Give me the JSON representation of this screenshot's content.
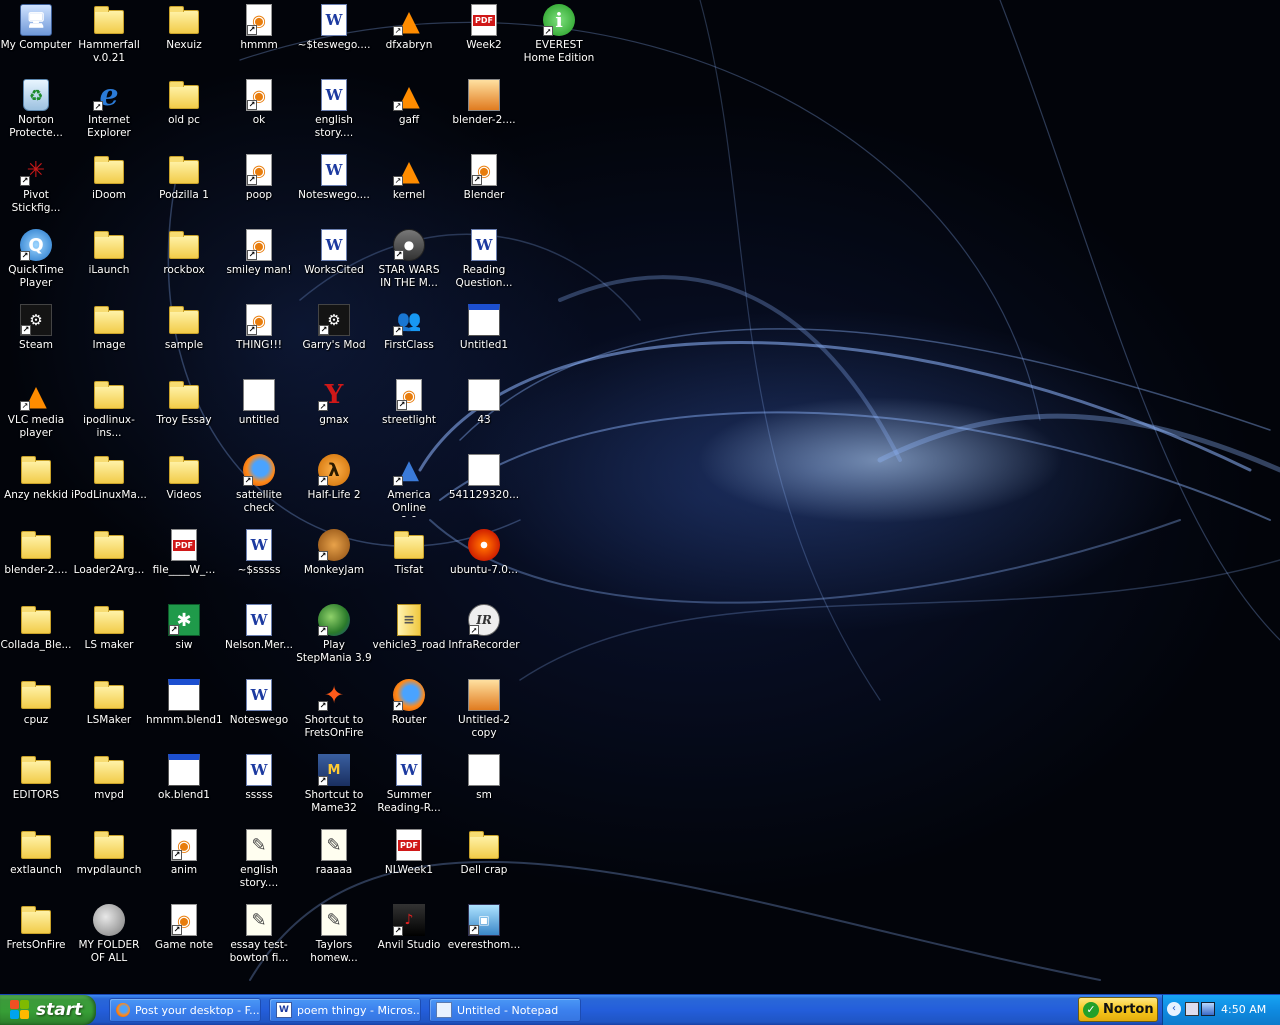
{
  "desktop": {
    "icons": [
      {
        "id": "my-computer",
        "label": "My Computer",
        "glyph": "computer"
      },
      {
        "id": "hammerfall",
        "label": "Hammerfall\nv.0.21",
        "glyph": "folder"
      },
      {
        "id": "nexuiz",
        "label": "Nexuiz",
        "glyph": "folder"
      },
      {
        "id": "hmmm",
        "label": "hmmm",
        "glyph": "blender"
      },
      {
        "id": "teswego",
        "label": "~$teswego....",
        "glyph": "word"
      },
      {
        "id": "dfxabryn",
        "label": "dfxabryn",
        "glyph": "vlc"
      },
      {
        "id": "week2",
        "label": "Week2",
        "glyph": "pdf"
      },
      {
        "id": "everest",
        "label": "EVEREST\nHome Edition",
        "glyph": "info"
      },
      {
        "id": "norton-protected",
        "label": "Norton\nProtecte...",
        "glyph": "recycle"
      },
      {
        "id": "internet-explorer",
        "label": "Internet\nExplorer",
        "glyph": "ie"
      },
      {
        "id": "old-pc",
        "label": "old pc",
        "glyph": "folder"
      },
      {
        "id": "ok",
        "label": "ok",
        "glyph": "blender"
      },
      {
        "id": "english-story-1",
        "label": "english\nstory....",
        "glyph": "word"
      },
      {
        "id": "gaff",
        "label": "gaff",
        "glyph": "vlc"
      },
      {
        "id": "blender-2-a",
        "label": "blender-2....",
        "glyph": "psd"
      },
      {
        "id": "pivot",
        "label": "Pivot\nStickfig...",
        "glyph": "pivot"
      },
      {
        "id": "idoom",
        "label": "iDoom",
        "glyph": "folder"
      },
      {
        "id": "podzilla",
        "label": "Podzilla 1",
        "glyph": "folder"
      },
      {
        "id": "poop",
        "label": "poop",
        "glyph": "blender"
      },
      {
        "id": "noteswego-1",
        "label": "Noteswego....",
        "glyph": "word"
      },
      {
        "id": "kernel",
        "label": "kernel",
        "glyph": "vlc"
      },
      {
        "id": "blender",
        "label": "Blender",
        "glyph": "blender"
      },
      {
        "id": "quicktime",
        "label": "QuickTime\nPlayer",
        "glyph": "qt"
      },
      {
        "id": "ilaunch",
        "label": "iLaunch",
        "glyph": "folder"
      },
      {
        "id": "rockbox",
        "label": "rockbox",
        "glyph": "folder"
      },
      {
        "id": "smiley-man",
        "label": "smiley man!",
        "glyph": "blender"
      },
      {
        "id": "works-cited",
        "label": "WorksCited",
        "glyph": "word"
      },
      {
        "id": "star-wars",
        "label": "STAR WARS\nIN THE M...",
        "glyph": "film"
      },
      {
        "id": "reading-question",
        "label": "Reading\nQuestion...",
        "glyph": "word"
      },
      {
        "id": "steam",
        "label": "Steam",
        "glyph": "steam"
      },
      {
        "id": "image",
        "label": "Image",
        "glyph": "folder"
      },
      {
        "id": "sample",
        "label": "sample",
        "glyph": "folder"
      },
      {
        "id": "thing",
        "label": "THING!!!",
        "glyph": "blender"
      },
      {
        "id": "garrys-mod",
        "label": "Garry's Mod",
        "glyph": "steam"
      },
      {
        "id": "firstclass",
        "label": "FirstClass",
        "glyph": "people"
      },
      {
        "id": "untitled1",
        "label": "Untitled1",
        "glyph": "window"
      },
      {
        "id": "vlc",
        "label": "VLC media\nplayer",
        "glyph": "vlc"
      },
      {
        "id": "ipodlinux-ins",
        "label": "ipodlinux-ins...",
        "glyph": "folder"
      },
      {
        "id": "troy-essay",
        "label": "Troy Essay",
        "glyph": "folder"
      },
      {
        "id": "untitled",
        "label": "untitled",
        "glyph": "app"
      },
      {
        "id": "gmax",
        "label": "gmax",
        "glyph": "gmax"
      },
      {
        "id": "streetlight",
        "label": "streetlight",
        "glyph": "blender"
      },
      {
        "id": "file-43",
        "label": "43",
        "glyph": "app"
      },
      {
        "id": "anzy-nekkid",
        "label": "Anzy nekkid",
        "glyph": "folder"
      },
      {
        "id": "ipodlinuxma",
        "label": "iPodLinuxMa...",
        "glyph": "folder"
      },
      {
        "id": "videos",
        "label": "Videos",
        "glyph": "folder"
      },
      {
        "id": "sattellite-check",
        "label": "sattellite check",
        "glyph": "firefox"
      },
      {
        "id": "half-life-2",
        "label": "Half-Life 2",
        "glyph": "hl"
      },
      {
        "id": "aol",
        "label": "America Online\n9.0",
        "glyph": "aol"
      },
      {
        "id": "file-541129320",
        "label": "541129320...",
        "glyph": "app"
      },
      {
        "id": "blender-2-b",
        "label": "blender-2....",
        "glyph": "folder"
      },
      {
        "id": "loader2arg",
        "label": "Loader2Arg...",
        "glyph": "folder"
      },
      {
        "id": "file-w",
        "label": "file____W_...",
        "glyph": "pdf"
      },
      {
        "id": "sssss-tilde",
        "label": "~$sssss",
        "glyph": "word"
      },
      {
        "id": "monkeyjam",
        "label": "MonkeyJam",
        "glyph": "monkey"
      },
      {
        "id": "tisfat",
        "label": "Tisfat",
        "glyph": "folder"
      },
      {
        "id": "ubuntu",
        "label": "ubuntu-7.0...",
        "glyph": "cd"
      },
      {
        "id": "collada-ble",
        "label": "Collada_Ble...",
        "glyph": "folder"
      },
      {
        "id": "ls-maker",
        "label": "LS maker",
        "glyph": "folder"
      },
      {
        "id": "siw",
        "label": "siw",
        "glyph": "siw"
      },
      {
        "id": "nelson-mer",
        "label": "Nelson.Mer...",
        "glyph": "word"
      },
      {
        "id": "stepmania",
        "label": "Play\nStepMania 3.9",
        "glyph": "globe"
      },
      {
        "id": "vehicle3-road",
        "label": "vehicle3_road",
        "glyph": "zip"
      },
      {
        "id": "infrarecorder",
        "label": "InfraRecorder",
        "glyph": "infra"
      },
      {
        "id": "cpuz",
        "label": "cpuz",
        "glyph": "folder"
      },
      {
        "id": "lsmaker",
        "label": "LSMaker",
        "glyph": "folder"
      },
      {
        "id": "hmmm-blend1",
        "label": "hmmm.blend1",
        "glyph": "window"
      },
      {
        "id": "noteswego-2",
        "label": "Noteswego",
        "glyph": "word"
      },
      {
        "id": "fretsonfire-shortcut",
        "label": "Shortcut to\nFretsOnFire",
        "glyph": "fof"
      },
      {
        "id": "router",
        "label": "Router",
        "glyph": "firefox"
      },
      {
        "id": "untitled-2-copy",
        "label": "Untitled-2\ncopy",
        "glyph": "psd"
      },
      {
        "id": "editors",
        "label": "EDITORS",
        "glyph": "folder"
      },
      {
        "id": "mvpd",
        "label": "mvpd",
        "glyph": "folder"
      },
      {
        "id": "ok-blend1",
        "label": "ok.blend1",
        "glyph": "window"
      },
      {
        "id": "sssss",
        "label": "sssss",
        "glyph": "word"
      },
      {
        "id": "mame32-shortcut",
        "label": "Shortcut to\nMame32",
        "glyph": "mame"
      },
      {
        "id": "summer-reading",
        "label": "Summer\nReading-R...",
        "glyph": "word"
      },
      {
        "id": "sm",
        "label": "sm",
        "glyph": "app"
      },
      {
        "id": "extlaunch",
        "label": "extlaunch",
        "glyph": "folder"
      },
      {
        "id": "mvpdlaunch",
        "label": "mvpdlaunch",
        "glyph": "folder"
      },
      {
        "id": "anim",
        "label": "anim",
        "glyph": "blender"
      },
      {
        "id": "english-story-2",
        "label": "english\nstory....",
        "glyph": "note"
      },
      {
        "id": "raaaaa",
        "label": "raaaaa",
        "glyph": "note"
      },
      {
        "id": "nlweek1",
        "label": "NLWeek1",
        "glyph": "pdf"
      },
      {
        "id": "dell-crap",
        "label": "Dell crap",
        "glyph": "folder"
      },
      {
        "id": "fretsonfire",
        "label": "FretsOnFire",
        "glyph": "folder"
      },
      {
        "id": "my-folder-of-all",
        "label": "MY FOLDER\nOF ALL",
        "glyph": "moon"
      },
      {
        "id": "game-note",
        "label": "Game note",
        "glyph": "blender"
      },
      {
        "id": "essay-test",
        "label": "essay test-\nbowton fi...",
        "glyph": "note"
      },
      {
        "id": "taylors-homew",
        "label": "Taylors\nhomew...",
        "glyph": "note"
      },
      {
        "id": "anvil-studio",
        "label": "Anvil Studio",
        "glyph": "anvil"
      },
      {
        "id": "everesthom",
        "label": "everesthom...",
        "glyph": "pc"
      }
    ]
  },
  "taskbar": {
    "start_label": "start",
    "buttons": [
      {
        "label": "Post your desktop - F...",
        "icon": "firefox-icon"
      },
      {
        "label": "poem thingy - Micros...",
        "icon": "word-icon"
      },
      {
        "label": "Untitled - Notepad",
        "icon": "notepad-icon"
      }
    ],
    "norton_label": "Norton",
    "clock": "4:50 AM"
  },
  "colors": {
    "taskbar_blue": "#245edb",
    "start_green": "#379e36",
    "tray_blue": "#0f8be1",
    "norton_yellow": "#f7c81e"
  }
}
